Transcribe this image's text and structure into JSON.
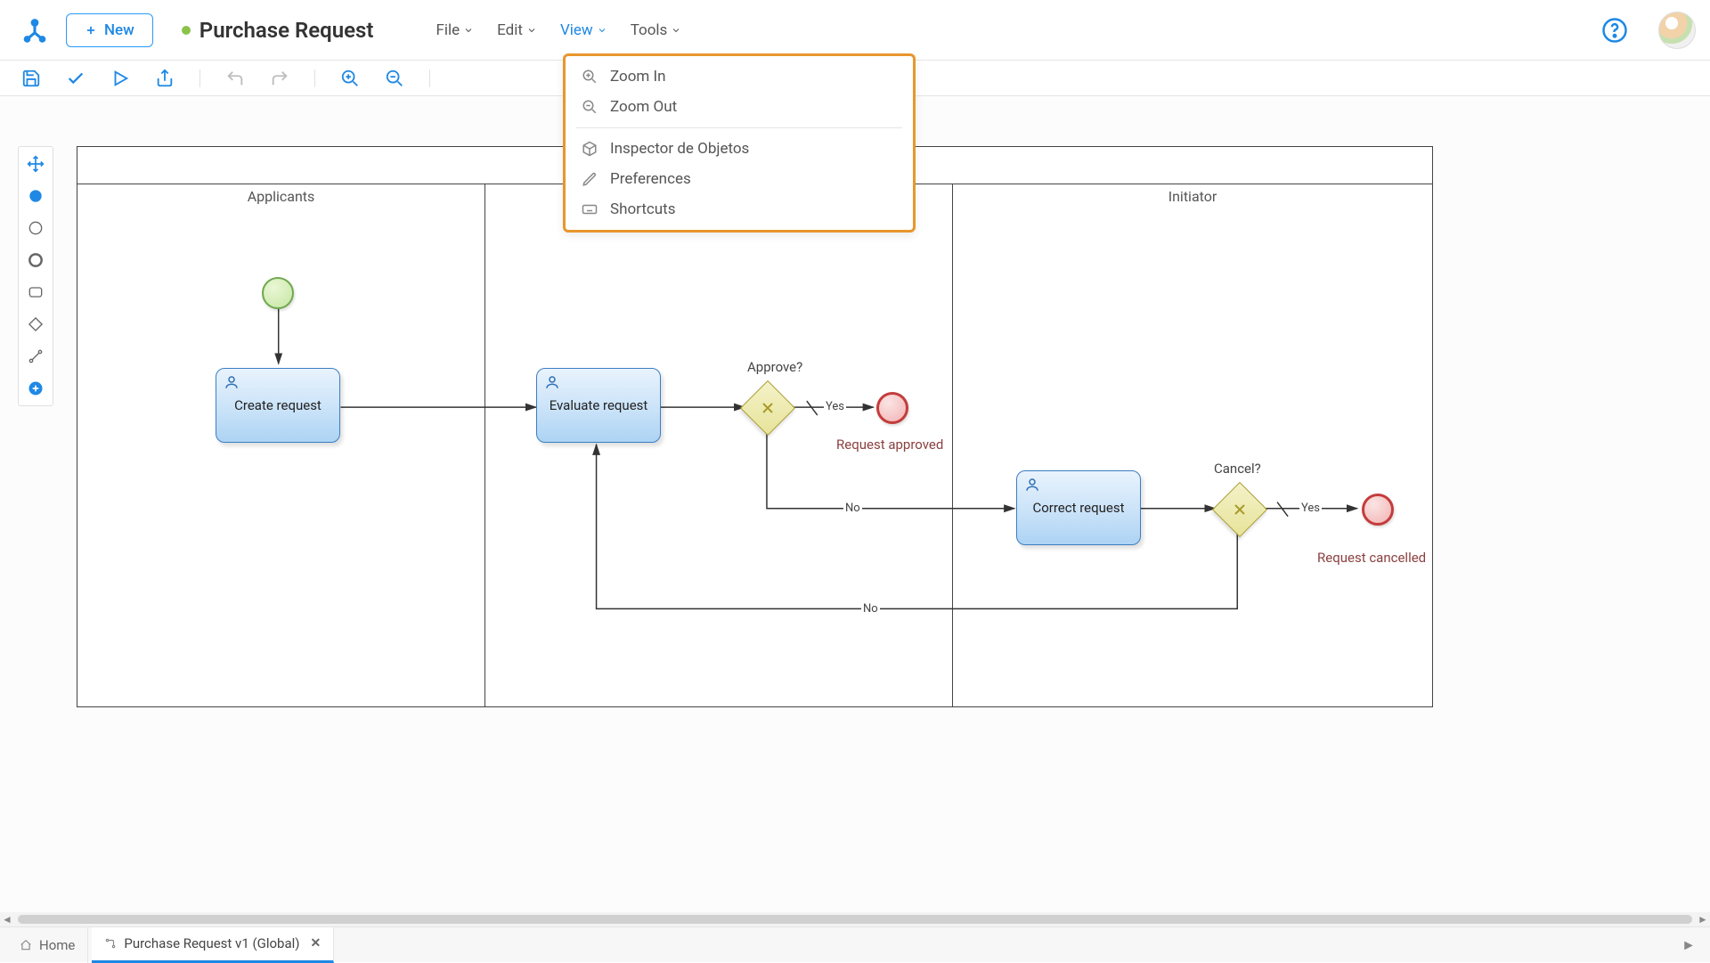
{
  "header": {
    "new_label": "New",
    "title": "Purchase Request",
    "status": "published"
  },
  "menus": {
    "file": "File",
    "edit": "Edit",
    "view": "View",
    "tools": "Tools"
  },
  "view_dropdown": {
    "zoom_in": "Zoom In",
    "zoom_out": "Zoom Out",
    "object_inspector": "Inspector de Objetos",
    "preferences": "Preferences",
    "shortcuts": "Shortcuts"
  },
  "toolbar_names": {
    "save": "save-icon",
    "check": "check-icon",
    "play": "play-icon",
    "share": "share-icon",
    "undo": "undo-icon",
    "redo": "redo-icon",
    "zoom_in": "zoom-in-icon",
    "zoom_out": "zoom-out-icon"
  },
  "diagram": {
    "lanes": {
      "applicants": "Applicants",
      "initiator": "Initiator",
      "middle": ""
    },
    "tasks": {
      "create": "Create request",
      "evaluate": "Evaluate request",
      "correct": "Correct request"
    },
    "gateways": {
      "approve": "Approve?",
      "cancel": "Cancel?"
    },
    "edges": {
      "yes1": "Yes",
      "no1": "No",
      "yes2": "Yes",
      "no2": "No"
    },
    "end_labels": {
      "approved": "Request approved",
      "cancelled": "Request cancelled"
    }
  },
  "tabs": {
    "home": "Home",
    "process": "Purchase Request v1 (Global)"
  }
}
